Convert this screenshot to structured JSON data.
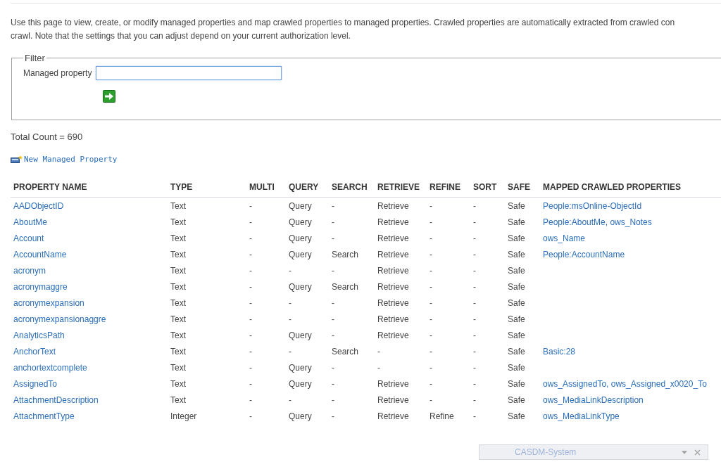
{
  "description": "Use this page to view, create, or modify managed properties and map crawled properties to managed properties. Crawled properties are automatically extracted from crawled con\ncrawl. Note that the settings that you can adjust depend on your current authorization level.",
  "filter": {
    "legend": "Filter",
    "label": "Managed property"
  },
  "total_count": "Total Count = 690",
  "new_link": "New Managed Property",
  "table": {
    "columns": [
      "PROPERTY NAME",
      "TYPE",
      "MULTI",
      "QUERY",
      "SEARCH",
      "RETRIEVE",
      "REFINE",
      "SORT",
      "SAFE",
      "MAPPED CRAWLED PROPERTIES"
    ],
    "rows": [
      [
        "AADObjectID",
        "Text",
        "-",
        "Query",
        "-",
        "Retrieve",
        "-",
        "-",
        "Safe",
        "People:msOnline-ObjectId"
      ],
      [
        "AboutMe",
        "Text",
        "-",
        "Query",
        "-",
        "Retrieve",
        "-",
        "-",
        "Safe",
        "People:AboutMe, ows_Notes"
      ],
      [
        "Account",
        "Text",
        "-",
        "Query",
        "-",
        "Retrieve",
        "-",
        "-",
        "Safe",
        "ows_Name"
      ],
      [
        "AccountName",
        "Text",
        "-",
        "Query",
        "Search",
        "Retrieve",
        "-",
        "-",
        "Safe",
        "People:AccountName"
      ],
      [
        "acronym",
        "Text",
        "-",
        "-",
        "-",
        "Retrieve",
        "-",
        "-",
        "Safe"
      ],
      [
        "acronymaggre",
        "Text",
        "-",
        "Query",
        "Search",
        "Retrieve",
        "-",
        "-",
        "Safe"
      ],
      [
        "acronymexpansion",
        "Text",
        "-",
        "-",
        "-",
        "Retrieve",
        "-",
        "-",
        "Safe"
      ],
      [
        "acronymexpansionaggre",
        "Text",
        "-",
        "-",
        "-",
        "Retrieve",
        "-",
        "-",
        "Safe"
      ],
      [
        "AnalyticsPath",
        "Text",
        "-",
        "Query",
        "-",
        "Retrieve",
        "-",
        "-",
        "Safe"
      ],
      [
        "AnchorText",
        "Text",
        "-",
        "-",
        "Search",
        "-",
        "-",
        "-",
        "Safe",
        "Basic:28"
      ],
      [
        "anchortextcomplete",
        "Text",
        "-",
        "Query",
        "-",
        "-",
        "-",
        "-",
        "Safe"
      ],
      [
        "AssignedTo",
        "Text",
        "-",
        "Query",
        "-",
        "Retrieve",
        "-",
        "-",
        "Safe",
        "ows_AssignedTo, ows_Assigned_x0020_To"
      ],
      [
        "AttachmentDescription",
        "Text",
        "-",
        "-",
        "-",
        "Retrieve",
        "-",
        "-",
        "Safe",
        "ows_MediaLinkDescription"
      ],
      [
        "AttachmentType",
        "Integer",
        "-",
        "Query",
        "-",
        "Retrieve",
        "Refine",
        "-",
        "Safe",
        "ows_MediaLinkType"
      ]
    ]
  },
  "notification": {
    "title": "CASDM-System"
  }
}
